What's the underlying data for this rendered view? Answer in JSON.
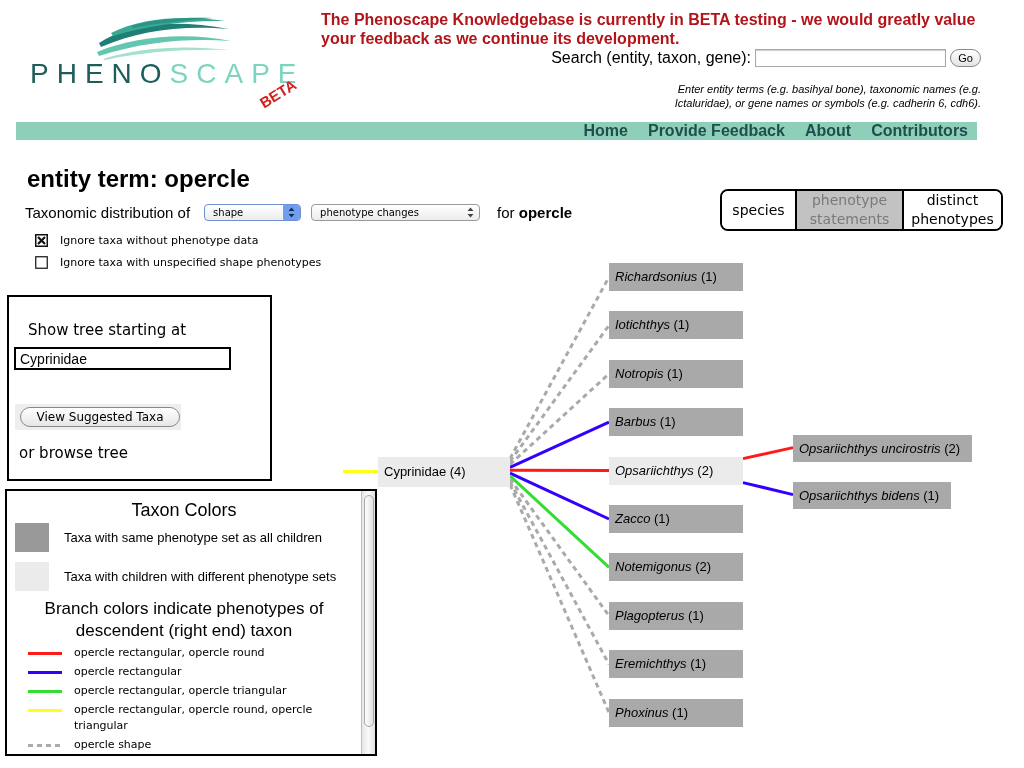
{
  "header": {
    "logo": {
      "dark_part": "PHENO",
      "light_part": "SCAPE",
      "badge": "BETA"
    },
    "notice": "The Phenoscape Knowledgebase is currently in BETA testing - we would greatly value your feedback as we continue its development.",
    "search": {
      "label": "Search (entity, taxon, gene):",
      "button": "Go"
    },
    "hint": "Enter entity terms (e.g. basihyal bone), taxonomic names (e.g. Ictaluridae), or gene names or symbols (e.g. cadherin 6, cdh6)."
  },
  "nav": [
    "Home",
    "Provide Feedback",
    "About",
    "Contributors"
  ],
  "page_title": "entity term: opercle",
  "distribution": {
    "prefix": "Taxonomic distribution of",
    "selects": [
      {
        "value": "shape",
        "focused": true
      },
      {
        "value": "phenotype changes",
        "focused": false
      }
    ],
    "suffix": "for **opercle**"
  },
  "view_toggle": [
    {
      "label": "species",
      "selected": false
    },
    {
      "label": "phenotype statements",
      "selected": true
    },
    {
      "label": "distinct phenotypes",
      "selected": false
    }
  ],
  "options": [
    {
      "label": "Ignore taxa without phenotype data",
      "checked": true
    },
    {
      "label": "Ignore taxa with unspecified shape phenotypes",
      "checked": false
    }
  ],
  "tree_start": {
    "label": "Show tree starting at",
    "value": "Cyprinidae",
    "button": "View Suggested Taxa",
    "browse": "or browse tree"
  },
  "legend": {
    "title": "Taxon Colors",
    "taxon_colors": [
      {
        "color": "#999999",
        "label": "Taxa with same phenotype set as all children"
      },
      {
        "color": "#ebebeb",
        "label": "Taxa with children with different phenotype sets"
      }
    ],
    "branch_title": "Branch colors indicate phenotypes of descendent (right end) taxon",
    "branch_colors": [
      {
        "color": "#ff1a1a",
        "dashed": false,
        "label": "opercle rectangular, opercle round"
      },
      {
        "color": "#3300ff",
        "dashed": false,
        "label": "opercle rectangular"
      },
      {
        "color": "#33dd33",
        "dashed": false,
        "label": "opercle rectangular, opercle triangular"
      },
      {
        "color": "#ffff1a",
        "dashed": false,
        "label": "opercle rectangular, opercle round, opercle triangular"
      },
      {
        "color": "#aaaaaa",
        "dashed": true,
        "label": "opercle shape"
      }
    ]
  },
  "tree": {
    "label": "Cyprinidae (4)",
    "color": "#ebebeb",
    "branch": {
      "color": "#ffff1a"
    },
    "children": [
      {
        "label": "*Richardsonius* (1)",
        "color": "#a9a9a9",
        "branch": {
          "color": "#aaaaaa"
        }
      },
      {
        "label": "*Iotichthys* (1)",
        "color": "#a9a9a9",
        "branch": {
          "color": "#aaaaaa"
        }
      },
      {
        "label": "*Notropis* (1)",
        "color": "#a9a9a9",
        "branch": {
          "color": "#aaaaaa"
        }
      },
      {
        "label": "*Barbus* (1)",
        "color": "#a9a9a9",
        "branch": {
          "color": "#3300ff"
        }
      },
      {
        "label": "*Opsariichthys* (2)",
        "color": "#ebebeb",
        "branch": {
          "color": "#ff1a1a"
        },
        "children": [
          {
            "label": "*Opsariichthys uncirostris* (2)",
            "color": "#a9a9a9",
            "branch": {
              "color": "#ff1a1a"
            }
          },
          {
            "label": "*Opsariichthys bidens* (1)",
            "color": "#a9a9a9",
            "branch": {
              "color": "#3300ff"
            }
          }
        ]
      },
      {
        "label": "*Zacco* (1)",
        "color": "#a9a9a9",
        "branch": {
          "color": "#3300ff"
        }
      },
      {
        "label": "*Notemigonus* (2)",
        "color": "#a9a9a9",
        "branch": {
          "color": "#33dd33"
        }
      },
      {
        "label": "*Plagopterus* (1)",
        "color": "#a9a9a9",
        "branch": {
          "color": "#aaaaaa"
        }
      },
      {
        "label": "*Eremichthys* (1)",
        "color": "#a9a9a9",
        "branch": {
          "color": "#aaaaaa"
        }
      },
      {
        "label": "*Phoxinus* (1)",
        "color": "#a9a9a9",
        "branch": {
          "color": "#aaaaaa"
        }
      }
    ]
  }
}
